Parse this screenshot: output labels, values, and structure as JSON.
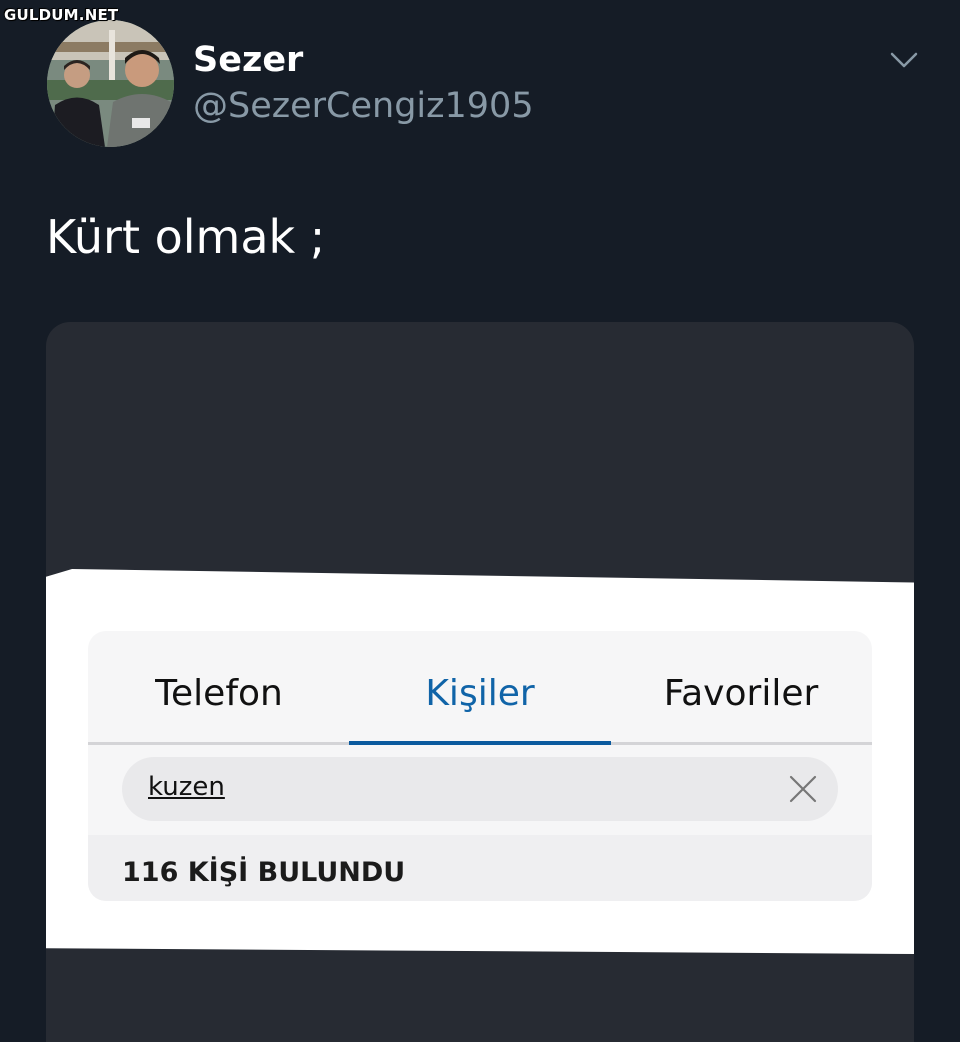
{
  "watermark": "GULDUM.NET",
  "tweet": {
    "display_name": "Sezer",
    "handle": "@SezerCengiz1905",
    "text": "Kürt olmak ;"
  },
  "screenshot": {
    "tabs": [
      {
        "label": "Telefon",
        "active": false
      },
      {
        "label": "Kişiler",
        "active": true
      },
      {
        "label": "Favoriler",
        "active": false
      }
    ],
    "search": {
      "value": "kuzen"
    },
    "result_text": "116 KİŞİ BULUNDU"
  },
  "colors": {
    "background": "#151c26",
    "handle": "#8899a6",
    "active_tab": "#1064a8"
  },
  "icons": {
    "menu": "chevron-down-icon",
    "clear": "close-icon"
  }
}
